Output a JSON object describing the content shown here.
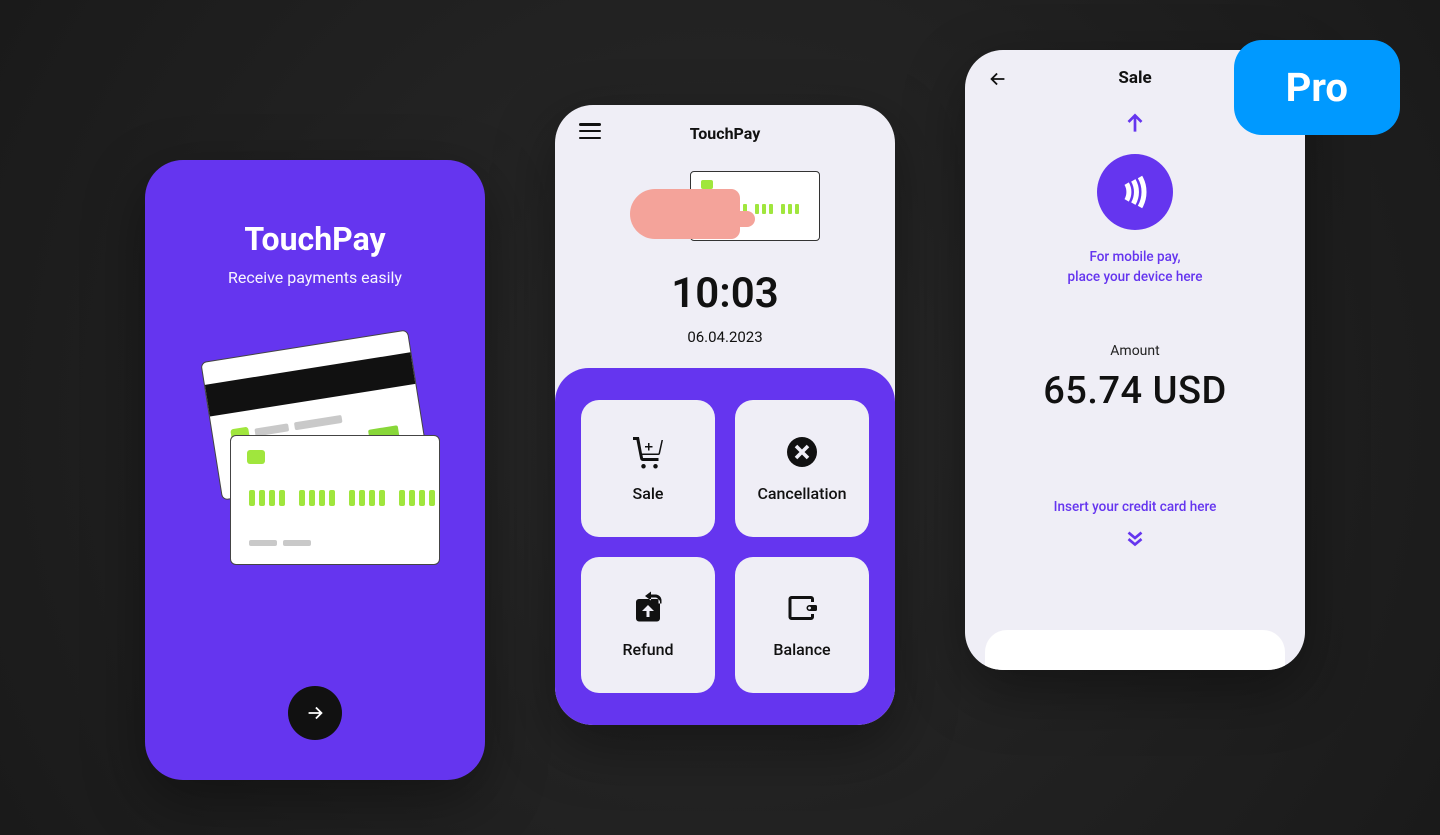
{
  "badge": {
    "label": "Pro"
  },
  "onboarding": {
    "title": "TouchPay",
    "subtitle": "Receive payments easily"
  },
  "home": {
    "title": "TouchPay",
    "time": "10:03",
    "date": "06.04.2023",
    "tiles": {
      "sale": "Sale",
      "cancellation": "Cancellation",
      "refund": "Refund",
      "balance": "Balance"
    }
  },
  "sale": {
    "title": "Sale",
    "mobile_line1": "For mobile pay,",
    "mobile_line2": "place your device here",
    "amount_label": "Amount",
    "amount_value": "65.74 USD",
    "insert_text": "Insert your credit card here"
  }
}
